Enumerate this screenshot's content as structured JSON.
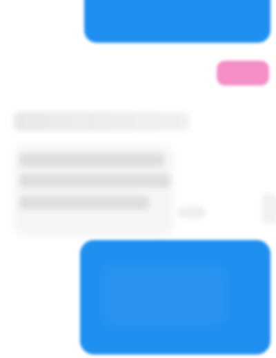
{
  "app": {
    "type": "chat-thread"
  },
  "colors": {
    "outgoing_bubble": "#1f8ff0",
    "reaction_tag": "#f48fc6",
    "incoming_text_placeholder": "#dedede"
  },
  "messages": {
    "top_outgoing": {
      "direction": "outgoing",
      "text": ""
    },
    "reaction": {
      "label": ""
    },
    "incoming": {
      "direction": "incoming",
      "sender": "",
      "text": "",
      "timestamp": ""
    },
    "bottom_outgoing": {
      "direction": "outgoing",
      "text": ""
    }
  }
}
